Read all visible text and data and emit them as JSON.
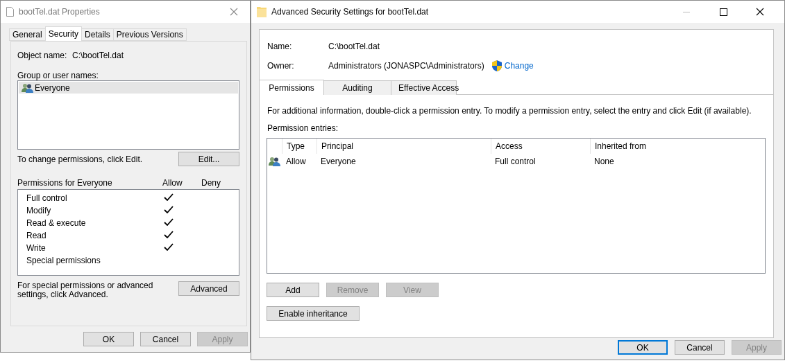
{
  "properties_window": {
    "title": "bootTel.dat Properties",
    "tabs": [
      {
        "label": "General",
        "selected": false
      },
      {
        "label": "Security",
        "selected": true
      },
      {
        "label": "Details",
        "selected": false
      },
      {
        "label": "Previous Versions",
        "selected": false
      }
    ],
    "object_name_label": "Object name:",
    "object_name": "C:\\bootTel.dat",
    "groups_label": "Group or user names:",
    "groups": [
      {
        "name": "Everyone",
        "selected": true
      }
    ],
    "change_hint": "To change permissions, click Edit.",
    "edit_button": "Edit...",
    "permissions_label": "Permissions for Everyone",
    "allow_header": "Allow",
    "deny_header": "Deny",
    "permissions": [
      {
        "name": "Full control",
        "allow": true,
        "deny": false
      },
      {
        "name": "Modify",
        "allow": true,
        "deny": false
      },
      {
        "name": "Read & execute",
        "allow": true,
        "deny": false
      },
      {
        "name": "Read",
        "allow": true,
        "deny": false
      },
      {
        "name": "Write",
        "allow": true,
        "deny": false
      },
      {
        "name": "Special permissions",
        "allow": false,
        "deny": false
      }
    ],
    "advanced_hint": "For special permissions or advanced settings, click Advanced.",
    "advanced_button": "Advanced",
    "buttons": [
      {
        "label": "OK",
        "disabled": false
      },
      {
        "label": "Cancel",
        "disabled": false
      },
      {
        "label": "Apply",
        "disabled": true
      }
    ]
  },
  "advanced_window": {
    "title": "Advanced Security Settings for bootTel.dat",
    "name_label": "Name:",
    "name": "C:\\bootTel.dat",
    "owner_label": "Owner:",
    "owner": "Administrators (JONASPC\\Administrators)",
    "change_link": "Change",
    "tabs": [
      {
        "label": "Permissions",
        "selected": true
      },
      {
        "label": "Auditing",
        "selected": false
      },
      {
        "label": "Effective Access",
        "selected": false
      }
    ],
    "info": "For additional information, double-click a permission entry. To modify a permission entry, select the entry and click Edit (if available).",
    "entries_label": "Permission entries:",
    "columns": [
      "Type",
      "Principal",
      "Access",
      "Inherited from"
    ],
    "rows": [
      {
        "type": "Allow",
        "principal": "Everyone",
        "access": "Full control",
        "inherited_from": "None"
      }
    ],
    "entry_buttons": [
      {
        "label": "Add",
        "disabled": false
      },
      {
        "label": "Remove",
        "disabled": true
      },
      {
        "label": "View",
        "disabled": true
      }
    ],
    "inheritance_button": "Enable inheritance",
    "buttons": [
      {
        "label": "OK",
        "disabled": false,
        "default": true
      },
      {
        "label": "Cancel",
        "disabled": false,
        "default": false
      },
      {
        "label": "Apply",
        "disabled": true,
        "default": false
      }
    ]
  }
}
